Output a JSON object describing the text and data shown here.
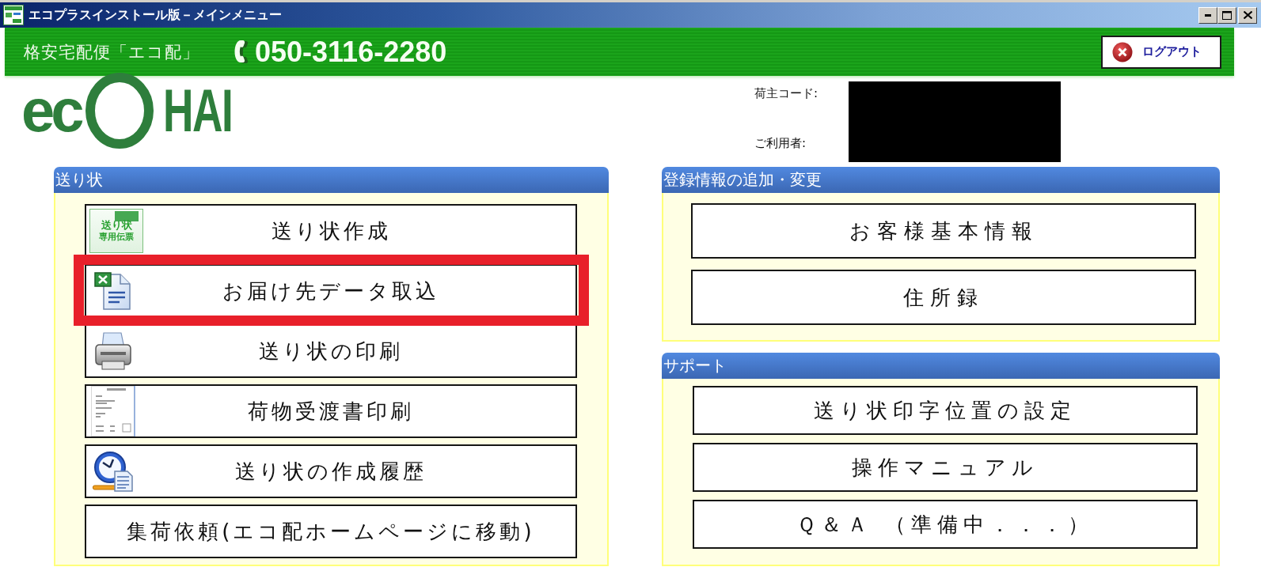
{
  "window": {
    "title": "エコプラスインストール版－メインメニュー"
  },
  "header": {
    "service_name": "格安宅配便「エコ配」",
    "phone": "050-3116-2280",
    "logout_button": "ログアウト"
  },
  "logo": {
    "prefix": "ec",
    "suffix": "HAI"
  },
  "account": {
    "redacted": true,
    "fields": [
      {
        "label": "荷主コード:"
      },
      {
        "label": "ご利用者:"
      }
    ]
  },
  "panels": [
    {
      "title": "送り状",
      "buttons": [
        {
          "label": "送り状作成",
          "kind": "create",
          "highlighted": false,
          "thumbnail_text": [
            "送り状",
            "専用伝票"
          ]
        },
        {
          "label": "お届け先データ取込",
          "kind": "import",
          "highlighted": true
        },
        {
          "label": "送り状の印刷",
          "kind": "print",
          "highlighted": false
        },
        {
          "label": "荷物受渡書印刷",
          "kind": "receipt",
          "highlighted": false
        },
        {
          "label": "送り状の作成履歴",
          "kind": "history",
          "highlighted": false
        },
        {
          "label": "集荷依頼(エコ配ホームページに移動)",
          "kind": "link",
          "highlighted": false
        }
      ]
    },
    {
      "title": "登録情報の追加・変更",
      "buttons": [
        {
          "label": "お客様基本情報",
          "kind": "text",
          "highlighted": false
        },
        {
          "label": "住所録",
          "kind": "text",
          "highlighted": false
        }
      ]
    },
    {
      "title": "サポート",
      "buttons": [
        {
          "label": "送り状印字位置の設定",
          "kind": "text",
          "highlighted": false
        },
        {
          "label": "操作マニュアル",
          "kind": "text",
          "highlighted": false
        },
        {
          "label": "Ｑ＆Ａ （準備中．．．）",
          "kind": "text",
          "highlighted": false
        }
      ]
    }
  ]
}
